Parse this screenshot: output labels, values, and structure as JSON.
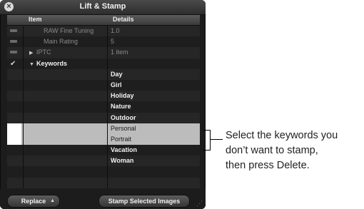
{
  "window": {
    "title": "Lift & Stamp",
    "close_icon": "close-icon"
  },
  "table": {
    "headers": {
      "item": "Item",
      "details": "Details"
    },
    "rows": [
      {
        "check": "dash",
        "item": "RAW Fine Tuning",
        "details": "1.0",
        "dim": true,
        "indent": 2
      },
      {
        "check": "dash",
        "item": "Main Rating",
        "details": "5",
        "dim": true,
        "indent": 2
      },
      {
        "check": "dash",
        "item": "IPTC",
        "details": "1 item",
        "dim": true,
        "triangle": "right",
        "indent": 1
      },
      {
        "check": "checkmark",
        "item": "Keywords",
        "details": "",
        "dim": false,
        "triangle": "down",
        "indent": 1
      },
      {
        "check": "",
        "item": "",
        "details": "Day"
      },
      {
        "check": "",
        "item": "",
        "details": "Girl"
      },
      {
        "check": "",
        "item": "",
        "details": "Holiday"
      },
      {
        "check": "",
        "item": "",
        "details": "Nature"
      },
      {
        "check": "",
        "item": "",
        "details": "Outdoor"
      },
      {
        "check": "",
        "item": "",
        "details": "Personal",
        "selected": true
      },
      {
        "check": "",
        "item": "",
        "details": "Portrait",
        "selected": true
      },
      {
        "check": "",
        "item": "",
        "details": "Vacation"
      },
      {
        "check": "",
        "item": "",
        "details": "Woman"
      },
      {
        "check": "",
        "item": "",
        "details": ""
      },
      {
        "check": "",
        "item": "",
        "details": ""
      }
    ]
  },
  "footer": {
    "replace_label": "Replace",
    "stamp_label": "Stamp Selected Images"
  },
  "callout": {
    "lines": [
      "Select the keywords you",
      "don’t want to stamp,",
      "then press Delete."
    ]
  }
}
